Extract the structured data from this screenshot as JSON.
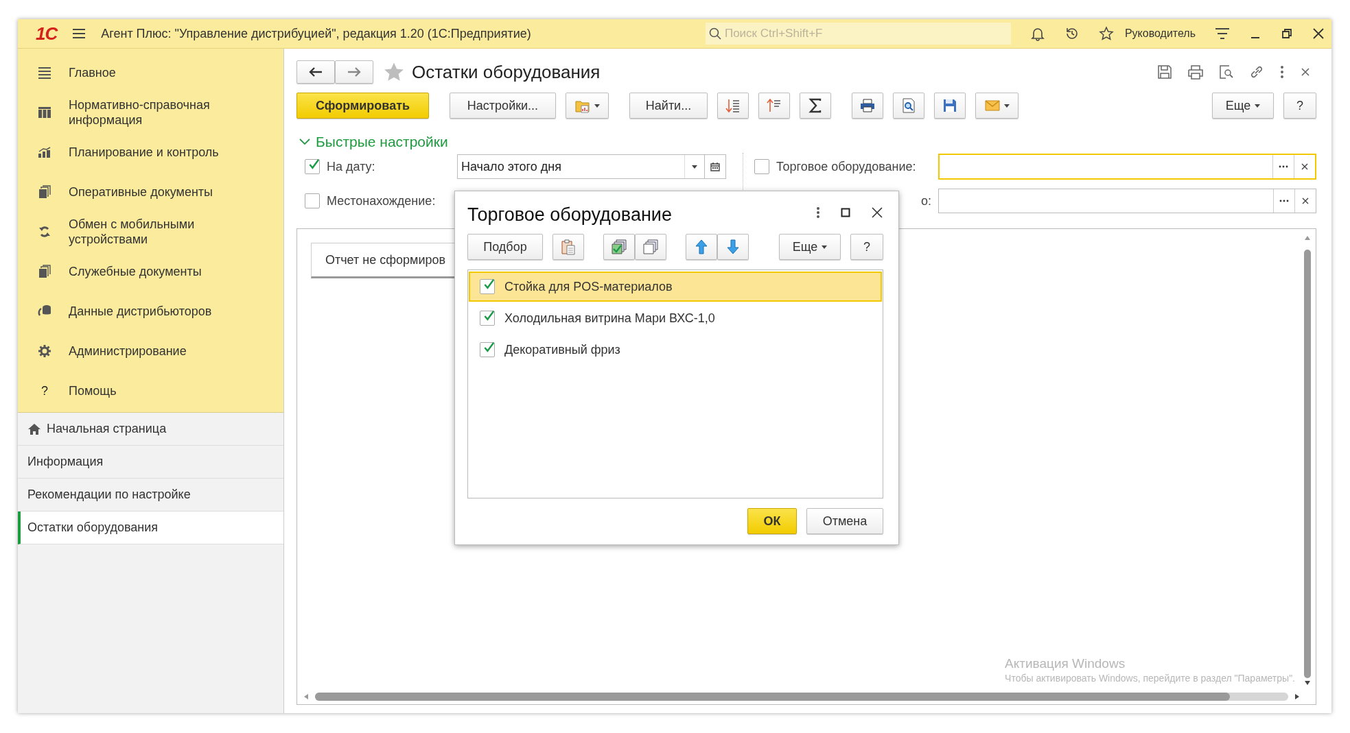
{
  "window": {
    "logo": "1С",
    "title": "Агент Плюс: \"Управление дистрибуцией\", редакция 1.20  (1С:Предприятие)",
    "search_placeholder": "Поиск Ctrl+Shift+F",
    "user": "Руководитель"
  },
  "sidebar": {
    "sections": [
      {
        "label": "Главное"
      },
      {
        "label": "Нормативно-справочная информация"
      },
      {
        "label": "Планирование и контроль"
      },
      {
        "label": "Оперативные документы"
      },
      {
        "label": "Обмен с мобильными устройствами"
      },
      {
        "label": "Служебные документы"
      },
      {
        "label": "Данные дистрибьюторов"
      },
      {
        "label": "Администрирование"
      },
      {
        "label": "Помощь",
        "glyph": "?"
      }
    ],
    "pages": [
      {
        "label": "Начальная страница",
        "selected": false
      },
      {
        "label": "Информация",
        "selected": false
      },
      {
        "label": "Рекомендации по настройке",
        "selected": false
      },
      {
        "label": "Остатки оборудования",
        "selected": true
      }
    ]
  },
  "form": {
    "title": "Остатки оборудования",
    "toolbar": {
      "generate": "Сформировать",
      "settings": "Настройки...",
      "find": "Найти...",
      "more": "Еще",
      "help": "?"
    },
    "quick_settings": {
      "title": "Быстрые настройки",
      "expanded": true
    },
    "left_fields": [
      {
        "label": "На дату:",
        "checked": true,
        "value": "Начало этого дня"
      },
      {
        "label": "Местонахождение:",
        "checked": false
      }
    ],
    "right_fields": [
      {
        "label": "Торговое оборудование:",
        "checked": false,
        "focused": true
      },
      {
        "label": "о:",
        "focused": false
      }
    ],
    "report_tab": "Отчет не сформиров"
  },
  "dialog": {
    "title": "Торговое оборудование",
    "pick": "Подбор",
    "more": "Еще",
    "help": "?",
    "items": [
      {
        "label": "Стойка для POS-материалов",
        "checked": true,
        "selected": true
      },
      {
        "label": "Холодильная витрина Мари ВХС-1,0",
        "checked": true,
        "selected": false
      },
      {
        "label": "Декоративный фриз",
        "checked": true,
        "selected": false
      }
    ],
    "ok": "ОК",
    "cancel": "Отмена"
  },
  "os_notice": {
    "title": "Активация Windows",
    "text": "Чтобы активировать Windows, перейдите в раздел \"Параметры\"."
  }
}
